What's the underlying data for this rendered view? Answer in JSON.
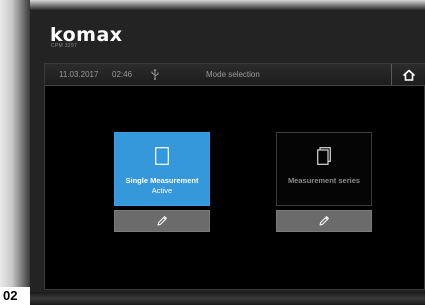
{
  "device": {
    "brand": "komax",
    "model": "CPM 3297"
  },
  "status_bar": {
    "date": "11.03.2017",
    "time": "02:46",
    "usb_icon": "usb-icon",
    "title": "Mode selection",
    "home_icon": "home-icon"
  },
  "tiles": [
    {
      "label": "Single Measurement",
      "sublabel": "Active",
      "icon": "single-page-icon",
      "state": "active",
      "color": "#3498db"
    },
    {
      "label": "Measurement series",
      "icon": "stacked-pages-icon",
      "state": "inactive",
      "color": "#050505"
    }
  ],
  "edit_buttons": [
    {
      "icon": "pencil-icon"
    },
    {
      "icon": "pencil-icon"
    }
  ],
  "figure_label": "02"
}
